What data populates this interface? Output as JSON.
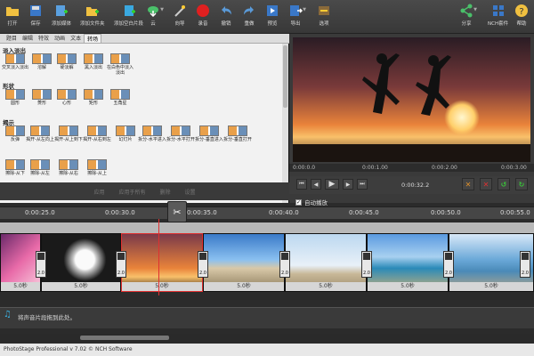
{
  "toolbar": {
    "items": [
      {
        "label": "打开",
        "icon": "folder-open-icon"
      },
      {
        "label": "保存",
        "icon": "save-icon"
      },
      {
        "label": "添加媒体",
        "icon": "add-media-icon"
      },
      {
        "label": "添加文件夹",
        "icon": "add-folder-icon"
      },
      {
        "label": "添加空白片段",
        "icon": "add-blank-clip-icon"
      },
      {
        "label": "云",
        "icon": "cloud-icon"
      },
      {
        "label": "向导",
        "icon": "wizard-icon"
      },
      {
        "label": "录音",
        "icon": "record-icon"
      },
      {
        "label": "撤销",
        "icon": "undo-icon"
      },
      {
        "label": "重做",
        "icon": "redo-icon"
      },
      {
        "label": "预览",
        "icon": "preview-icon"
      },
      {
        "label": "导出",
        "icon": "export-icon"
      },
      {
        "label": "选项",
        "icon": "options-icon"
      },
      {
        "label": "分享",
        "icon": "share-icon"
      },
      {
        "label": "NCH套件",
        "icon": "nch-suite-icon"
      },
      {
        "label": "帮助",
        "icon": "help-icon"
      }
    ]
  },
  "tabs": [
    "题目",
    "编辑",
    "特效",
    "动画",
    "文本",
    "转场"
  ],
  "active_tab": "转场",
  "sections": {
    "fade": "淡入淡出",
    "shape": "形状",
    "reveal": "揭示"
  },
  "transitions": {
    "fade": [
      "交叉淡入淡出",
      "溶解",
      "硬淡解",
      "黑入淡出",
      "在白色中淡入淡出"
    ],
    "shape": [
      "圆形",
      "菱形",
      "心形",
      "矩形",
      "五角星"
    ],
    "reveal": [
      "反弹",
      "揭开-从左向上",
      "揭开-从上到下",
      "揭开-从右到左",
      "幻灯片",
      "拆分-水平进入",
      "拆分-水平打开",
      "拆分-垂直进入",
      "拆分-垂直打开"
    ],
    "reveal2": [
      "擦除-从下",
      "擦除-从左",
      "擦除-从右",
      "擦除-从上"
    ]
  },
  "left_buttons": [
    "应用",
    "应用于所有",
    "删除",
    "设置"
  ],
  "preview": {
    "ruler": [
      "0:00:0.0",
      "0:00:1.00",
      "0:00:2.00",
      "0:00:3.00"
    ],
    "timecode": "0:00:32.2",
    "autoplay": "自动播放",
    "autoplay_checked": "✓"
  },
  "timeline": {
    "ticks": [
      "0:00:25.0",
      "0:00:30.0",
      "0:00:35.0",
      "0:00:40.0",
      "0:00:45.0",
      "0:00:50.0",
      "0:00:55.0"
    ],
    "clip_duration": "5.0秒",
    "transition_duration": "2.0",
    "audio_hint": "将声音片段拖到此处。"
  },
  "status": "PhotoStage Professional v 7.02 © NCH Software"
}
